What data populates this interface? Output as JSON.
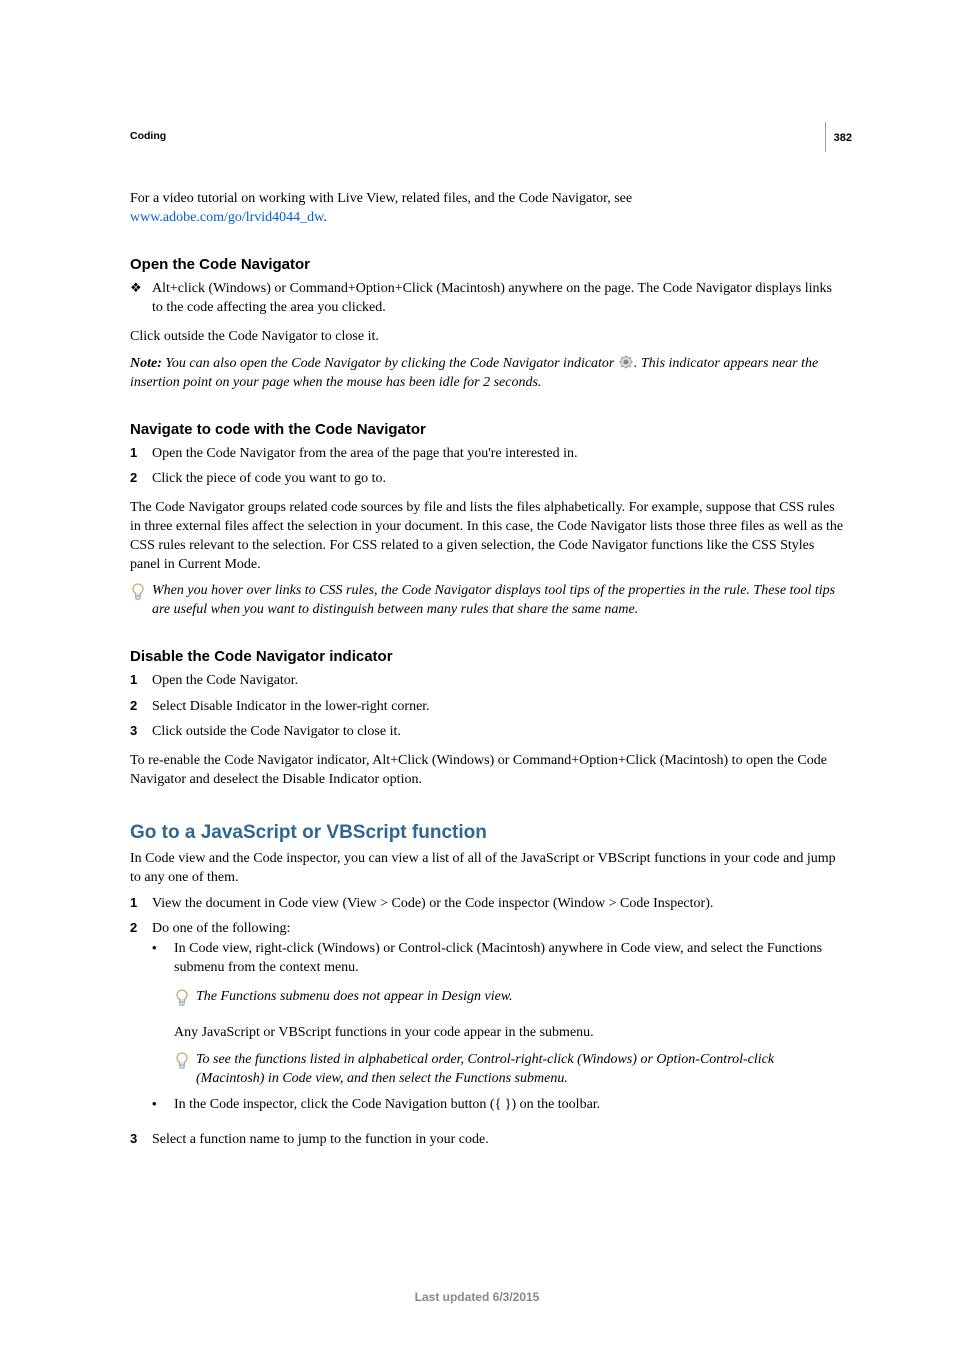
{
  "page_number": "382",
  "section": "Coding",
  "intro_pre": "For a video tutorial on working with Live View, related files, and the Code Navigator, see ",
  "intro_link": "www.adobe.com/go/lrvid4044_dw",
  "intro_post": ".",
  "open": {
    "heading": "Open the Code Navigator",
    "bullet_marker": "❖",
    "bullet": "Alt+click (Windows) or Command+Option+Click (Macintosh) anywhere on the page. The Code Navigator displays links to the code affecting the area you clicked.",
    "after": "Click outside the Code Navigator to close it.",
    "note_label": "Note:",
    "note_pre": " You can also open the Code Navigator by clicking the Code Navigator indicator ",
    "note_post": ". This indicator appears near the insertion point on your page when the mouse has been idle for 2 seconds."
  },
  "nav": {
    "heading": "Navigate to code with the Code Navigator",
    "steps": [
      "Open the Code Navigator from the area of the page that you're interested in.",
      "Click the piece of code you want to go to."
    ],
    "after": "The Code Navigator groups related code sources by file and lists the files alphabetically. For example, suppose that CSS rules in three external files affect the selection in your document. In this case, the Code Navigator lists those three files as well as the CSS rules relevant to the selection. For CSS related to a given selection, the Code Navigator functions like the CSS Styles panel in Current Mode.",
    "tip": "When you hover over links to CSS rules, the Code Navigator displays tool tips of the properties in the rule. These tool tips are useful when you want to distinguish between many rules that share the same name."
  },
  "disable": {
    "heading": "Disable the Code Navigator indicator",
    "steps": [
      "Open the Code Navigator.",
      "Select Disable Indicator in the lower-right corner.",
      "Click outside the Code Navigator to close it."
    ],
    "after": "To re-enable the Code Navigator indicator, Alt+Click (Windows) or Command+Option+Click (Macintosh) to open the Code Navigator and deselect the Disable Indicator option."
  },
  "goto": {
    "heading": "Go to a JavaScript or VBScript function",
    "intro": "In Code view and the Code inspector, you can view a list of all of the JavaScript or VBScript functions in your code and jump to any one of them.",
    "step1": "View the document in Code view (View > Code) or the Code inspector (Window > Code Inspector).",
    "step2": "Do one of the following:",
    "step2_b1": "In Code view, right-click (Windows) or Control-click (Macintosh) anywhere in Code view, and select the Functions submenu from the context menu.",
    "step2_tip1": "The Functions submenu does not appear in Design view.",
    "step2_any": "Any JavaScript or VBScript functions in your code appear in the submenu.",
    "step2_tip2": "To see the functions listed in alphabetical order, Control-right-click (Windows) or Option-Control-click (Macintosh) in Code view, and then select the Functions submenu.",
    "step2_b2": "In the Code inspector, click the Code Navigation button ({ }) on the toolbar.",
    "step3": "Select a function name to jump to the function in your code."
  },
  "footer": "Last updated 6/3/2015",
  "markers": {
    "n1": "1",
    "n2": "2",
    "n3": "3",
    "dot": "•"
  }
}
